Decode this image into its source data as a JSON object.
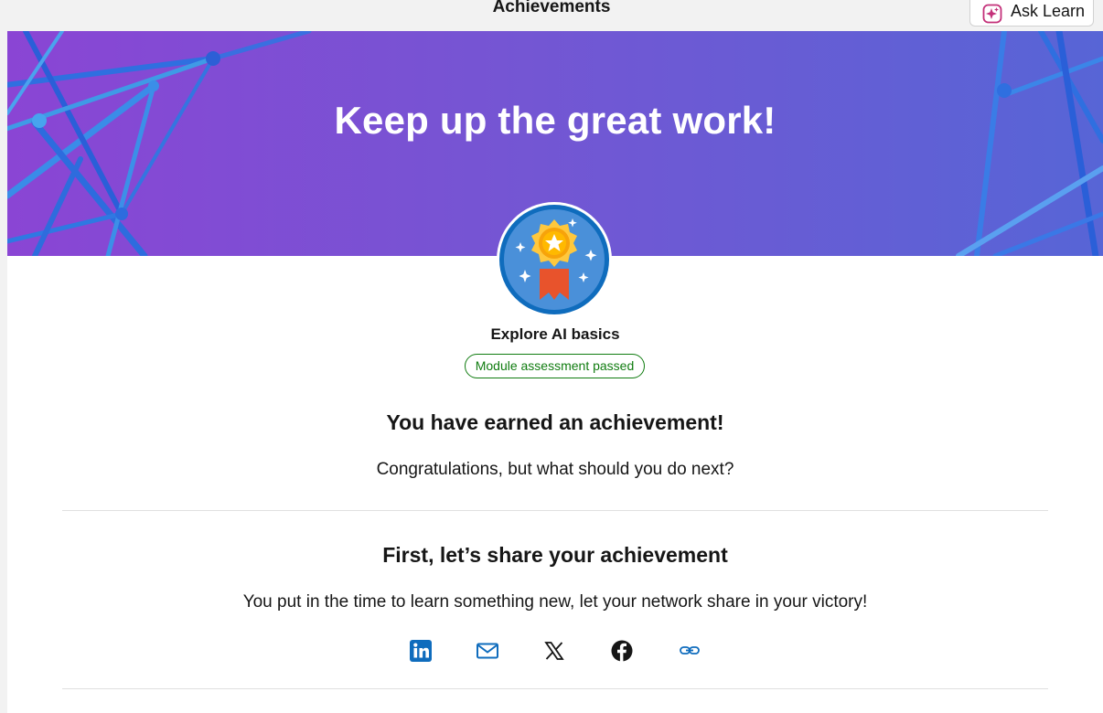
{
  "topbar": {
    "title": "Achievements",
    "ask_learn_label": "Ask Learn"
  },
  "hero": {
    "title": "Keep up the great work!"
  },
  "achievement": {
    "module_name": "Explore AI basics",
    "status_badge": "Module assessment passed",
    "badge_icon": "medal-star-icon"
  },
  "earned": {
    "heading": "You have earned an achievement!",
    "subtext": "Congratulations, but what should you do next?"
  },
  "share": {
    "heading": "First, let’s share your achievement",
    "subtext": "You put in the time to learn something new, let your network share in your victory!",
    "icons": [
      "linkedin-icon",
      "email-icon",
      "x-icon",
      "facebook-icon",
      "link-icon"
    ]
  },
  "colors": {
    "hero_gradient_start": "#8a45d4",
    "hero_gradient_end": "#5765d6",
    "success_green": "#107c10",
    "link_blue": "#0f6cbd"
  }
}
